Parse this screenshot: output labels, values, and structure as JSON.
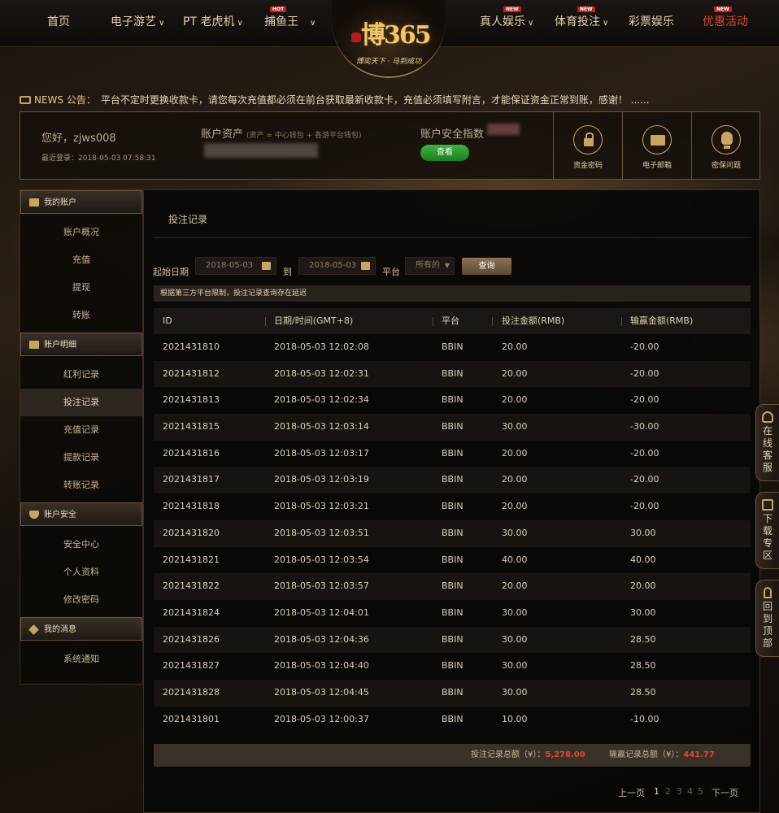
{
  "nav": {
    "left": [
      {
        "label": "首页",
        "chevron": false
      },
      {
        "label": "电子游艺",
        "chevron": true
      },
      {
        "label": "PT 老虎机",
        "chevron": true
      },
      {
        "label": "捕鱼王",
        "chevron": true,
        "badge": "HOT"
      }
    ],
    "right": [
      {
        "label": "真人娱乐",
        "chevron": true,
        "badge": "NEW"
      },
      {
        "label": "体育投注",
        "chevron": true,
        "badge": "NEW"
      },
      {
        "label": "彩票娱乐",
        "chevron": false
      },
      {
        "label": "优惠活动",
        "chevron": false,
        "badge": "NEW",
        "color": "#e0482e"
      }
    ]
  },
  "logo": {
    "text": "博365",
    "slogan": "博奕天下 · 马到成功"
  },
  "notice": {
    "title": "NEWS 公告：",
    "text": "平台不定时更换收款卡，请您每次充值都必须在前台获取最新收款卡，充值必须填写附言，才能保证资金正常到账，感谢！ ......"
  },
  "account": {
    "greeting": "您好，zjws008",
    "last_login": "最近登录：2018-05-03 07:58:31",
    "assets_label": "账户资产",
    "assets_note": "(资产 = 中心钱包 + 各游平台钱包)",
    "security_label": "账户安全指数",
    "view_button": "查看",
    "icons": [
      {
        "label": "资金密码",
        "icon": "lock-icon"
      },
      {
        "label": "电子邮箱",
        "icon": "mail-icon"
      },
      {
        "label": "密保问题",
        "icon": "lightbulb-icon"
      }
    ]
  },
  "sidebar": {
    "sections": [
      {
        "title": "我的账户",
        "icon": "account-icon",
        "items": [
          "账户概况",
          "充值",
          "提现",
          "转账"
        ]
      },
      {
        "title": "账户明细",
        "icon": "ledger-icon",
        "items": [
          "红利记录",
          "投注记录",
          "充值记录",
          "提款记录",
          "转账记录"
        ]
      },
      {
        "title": "账户安全",
        "icon": "shield-icon",
        "items": [
          "安全中心",
          "个人资料",
          "修改密码"
        ]
      },
      {
        "title": "我的消息",
        "icon": "diamond-icon",
        "items": [
          "系统通知"
        ]
      }
    ],
    "active_item": "投注记录"
  },
  "main": {
    "page_title": "投注记录",
    "filter": {
      "start_label": "起始日期",
      "start_value": "2018-05-03",
      "to_label": "到",
      "end_value": "2018-05-03",
      "platform_label": "平台",
      "platform_value": "所有的",
      "query_button": "查询"
    },
    "info": "根据第三方平台限制，投注记录查询存在延迟",
    "table": {
      "headers": [
        "ID",
        "日期/时间(GMT+8)",
        "平台",
        "投注金额(RMB)",
        "输赢金额(RMB)"
      ],
      "rows": [
        [
          "2021431810",
          "2018-05-03 12:02:08",
          "BBIN",
          "20.00",
          "-20.00"
        ],
        [
          "2021431812",
          "2018-05-03 12:02:31",
          "BBIN",
          "20.00",
          "-20.00"
        ],
        [
          "2021431813",
          "2018-05-03 12:02:34",
          "BBIN",
          "20.00",
          "-20.00"
        ],
        [
          "2021431815",
          "2018-05-03 12:03:14",
          "BBIN",
          "30.00",
          "-30.00"
        ],
        [
          "2021431816",
          "2018-05-03 12:03:17",
          "BBIN",
          "20.00",
          "-20.00"
        ],
        [
          "2021431817",
          "2018-05-03 12:03:19",
          "BBIN",
          "20.00",
          "-20.00"
        ],
        [
          "2021431818",
          "2018-05-03 12:03:21",
          "BBIN",
          "20.00",
          "-20.00"
        ],
        [
          "2021431820",
          "2018-05-03 12:03:51",
          "BBIN",
          "30.00",
          "30.00"
        ],
        [
          "2021431821",
          "2018-05-03 12:03:54",
          "BBIN",
          "40.00",
          "40.00"
        ],
        [
          "2021431822",
          "2018-05-03 12:03:57",
          "BBIN",
          "20.00",
          "20.00"
        ],
        [
          "2021431824",
          "2018-05-03 12:04:01",
          "BBIN",
          "30.00",
          "30.00"
        ],
        [
          "2021431826",
          "2018-05-03 12:04:36",
          "BBIN",
          "30.00",
          "28.50"
        ],
        [
          "2021431827",
          "2018-05-03 12:04:40",
          "BBIN",
          "30.00",
          "28.50"
        ],
        [
          "2021431828",
          "2018-05-03 12:04:45",
          "BBIN",
          "30.00",
          "28.50"
        ],
        [
          "2021431801",
          "2018-05-03 12:00:37",
          "BBIN",
          "10.00",
          "-10.00"
        ]
      ]
    },
    "summary": {
      "bet_label": "投注记录总额（¥）：",
      "bet_value": "5,278.00",
      "win_label": "输赢记录总额（¥）：",
      "win_value": "441.77"
    },
    "pager": {
      "prev": "上一页",
      "pages": [
        "1",
        "2",
        "3",
        "4",
        "5"
      ],
      "current": "1",
      "next": "下一页"
    }
  },
  "right_tabs": [
    {
      "label": "在线客服",
      "icon": "headset-icon"
    },
    {
      "label": "下载专区",
      "icon": "monitor-icon"
    },
    {
      "label": "回到顶部",
      "icon": "rocket-icon"
    }
  ],
  "colors": {
    "accent": "#c9a560",
    "highlight": "#e0482e",
    "green": "#2a9a2a"
  }
}
